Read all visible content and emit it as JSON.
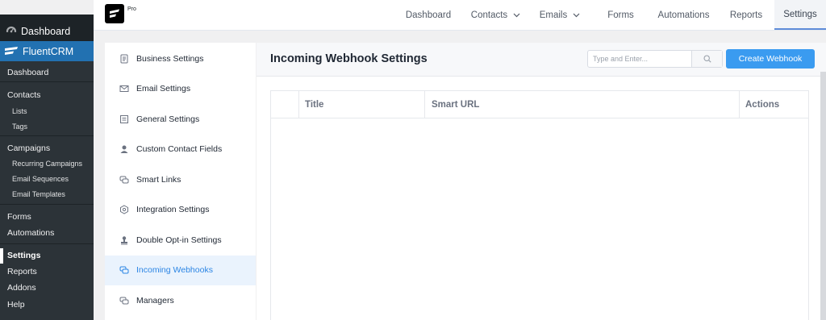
{
  "wp_sidebar": {
    "dashboard_label": "Dashboard",
    "plugin_label": "FluentCRM",
    "items": [
      {
        "label": "Dashboard",
        "level": "main"
      },
      {
        "label": "Contacts",
        "level": "main"
      },
      {
        "label": "Lists",
        "level": "sub"
      },
      {
        "label": "Tags",
        "level": "sub"
      },
      {
        "label": "Campaigns",
        "level": "main"
      },
      {
        "label": "Recurring Campaigns",
        "level": "sub"
      },
      {
        "label": "Email Sequences",
        "level": "sub"
      },
      {
        "label": "Email Templates",
        "level": "sub"
      },
      {
        "label": "Forms",
        "level": "main"
      },
      {
        "label": "Automations",
        "level": "main"
      },
      {
        "label": "Settings",
        "level": "main",
        "active": true
      },
      {
        "label": "Reports",
        "level": "main"
      },
      {
        "label": "Addons",
        "level": "main"
      },
      {
        "label": "Help",
        "level": "main"
      }
    ]
  },
  "brand": {
    "badge": "Pro"
  },
  "top_nav": {
    "items": [
      {
        "label": "Dashboard"
      },
      {
        "label": "Contacts",
        "dropdown": true
      },
      {
        "label": "Emails",
        "dropdown": true
      },
      {
        "label": "Forms"
      },
      {
        "label": "Automations"
      },
      {
        "label": "Reports"
      },
      {
        "label": "Settings",
        "active": true
      }
    ]
  },
  "settings_menu": {
    "items": [
      {
        "label": "Business Settings",
        "icon": "document-icon"
      },
      {
        "label": "Email Settings",
        "icon": "envelope-icon"
      },
      {
        "label": "General Settings",
        "icon": "list-icon"
      },
      {
        "label": "Custom Contact Fields",
        "icon": "user-icon"
      },
      {
        "label": "Smart Links",
        "icon": "chat-icon"
      },
      {
        "label": "Integration Settings",
        "icon": "puzzle-icon"
      },
      {
        "label": "Double Opt-in Settings",
        "icon": "stamp-icon"
      },
      {
        "label": "Incoming Webhooks",
        "icon": "webhook-icon",
        "active": true
      },
      {
        "label": "Managers",
        "icon": "chat-icon"
      }
    ]
  },
  "panel": {
    "title": "Incoming Webhook Settings",
    "search_placeholder": "Type and Enter...",
    "create_button": "Create Webhook"
  },
  "table": {
    "columns": [
      "",
      "Title",
      "Smart URL",
      "Actions"
    ],
    "rows": []
  },
  "colors": {
    "wp_sidebar_bg": "#1d2327",
    "wp_accent": "#2271b1",
    "primary_button": "#3a9bf0",
    "active_menu_text": "#2b85e4",
    "active_menu_bg": "#eaf3fd"
  }
}
